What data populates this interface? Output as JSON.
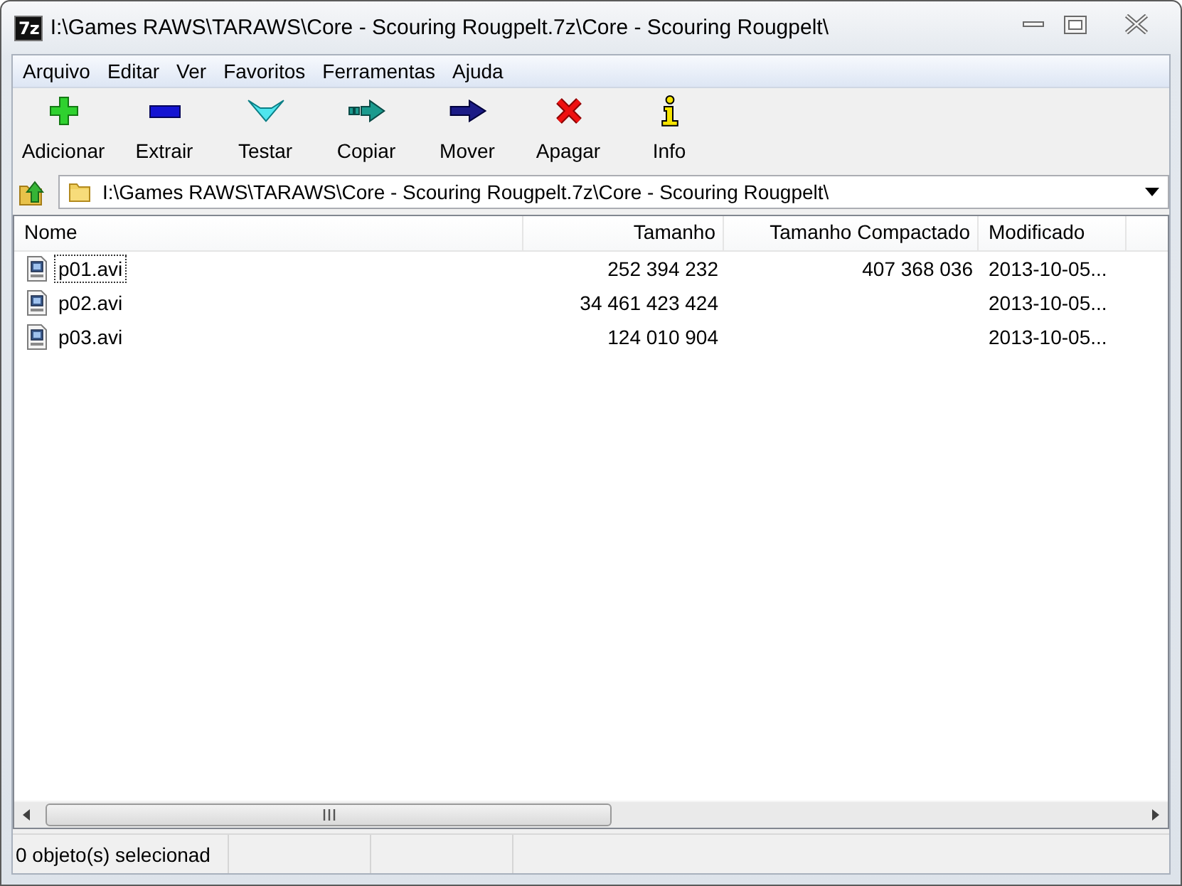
{
  "window": {
    "icon_label": "7z",
    "title": "I:\\Games RAWS\\TARAWS\\Core - Scouring Rougpelt.7z\\Core - Scouring Rougpelt\\"
  },
  "menu": [
    {
      "label": "Arquivo"
    },
    {
      "label": "Editar"
    },
    {
      "label": "Ver"
    },
    {
      "label": "Favoritos"
    },
    {
      "label": "Ferramentas"
    },
    {
      "label": "Ajuda"
    }
  ],
  "toolbar": [
    {
      "kind": "add",
      "label": "Adicionar"
    },
    {
      "kind": "extract",
      "label": "Extrair"
    },
    {
      "kind": "test",
      "label": "Testar"
    },
    {
      "kind": "copy",
      "label": "Copiar"
    },
    {
      "kind": "move",
      "label": "Mover"
    },
    {
      "kind": "delete",
      "label": "Apagar"
    },
    {
      "kind": "info",
      "label": "Info"
    }
  ],
  "address_bar": {
    "path": "I:\\Games RAWS\\TARAWS\\Core - Scouring Rougpelt.7z\\Core - Scouring Rougpelt\\"
  },
  "table": {
    "columns": [
      "Nome",
      "Tamanho",
      "Tamanho Compactado",
      "Modificado"
    ],
    "rows": [
      {
        "name": "p01.avi",
        "size": "252 394 232",
        "packed_size": "407 368 036",
        "modified": "2013-10-05...",
        "selected": false,
        "focused": true
      },
      {
        "name": "p02.avi",
        "size": "34 461 423 424",
        "modified": "2013-10-05...",
        "selected": false,
        "focused": false
      },
      {
        "name": "p03.avi",
        "size": "124 010 904",
        "modified": "2013-10-05...",
        "selected": false,
        "focused": false
      }
    ]
  },
  "status_bar": {
    "text": "0 objeto(s) selecionad"
  }
}
